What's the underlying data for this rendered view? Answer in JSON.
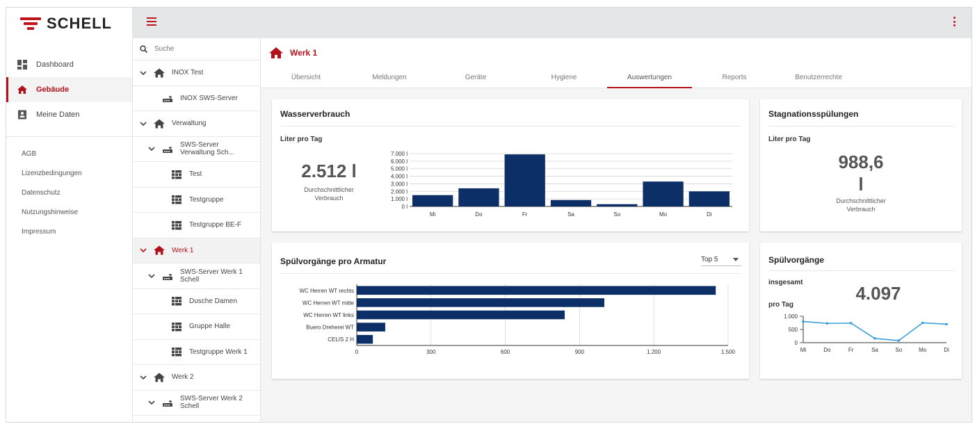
{
  "brand": {
    "name": "SCHELL",
    "color": "#c0141e"
  },
  "sidebar": {
    "nav": [
      {
        "label": "Dashboard",
        "icon": "dashboard-icon",
        "active": false
      },
      {
        "label": "Gebäude",
        "icon": "home-icon",
        "active": true
      },
      {
        "label": "Meine Daten",
        "icon": "contact-card-icon",
        "active": false
      }
    ],
    "links": [
      "AGB",
      "Lizenzbedingungen",
      "Datenschutz",
      "Nutzungshinweise",
      "Impressum"
    ]
  },
  "search": {
    "placeholder": "Suche"
  },
  "tree": [
    {
      "label": "INOX Test",
      "type": "building",
      "indent": 0,
      "expanded": true
    },
    {
      "label": "INOX SWS-Server",
      "type": "server",
      "indent": 1,
      "expanded": null
    },
    {
      "label": "Verwaltung",
      "type": "building",
      "indent": 0,
      "expanded": true
    },
    {
      "label": "SWS-Server\nVerwaltung Sch...",
      "type": "server",
      "indent": 1,
      "expanded": true
    },
    {
      "label": "Test",
      "type": "group",
      "indent": 2,
      "expanded": null
    },
    {
      "label": "Testgruppe",
      "type": "group",
      "indent": 2,
      "expanded": null
    },
    {
      "label": "Testgruppe BE-F",
      "type": "group",
      "indent": 2,
      "expanded": null
    },
    {
      "label": "Werk 1",
      "type": "building",
      "indent": 0,
      "expanded": true,
      "active": true
    },
    {
      "label": "SWS-Server Werk 1\nSchell",
      "type": "server",
      "indent": 1,
      "expanded": true
    },
    {
      "label": "Dusche Damen",
      "type": "group",
      "indent": 2,
      "expanded": null
    },
    {
      "label": "Gruppe Halle",
      "type": "group",
      "indent": 2,
      "expanded": null
    },
    {
      "label": "Testgruppe Werk 1",
      "type": "group",
      "indent": 2,
      "expanded": null
    },
    {
      "label": "Werk 2",
      "type": "building",
      "indent": 0,
      "expanded": true
    },
    {
      "label": "SWS-Server Werk 2\nSchell",
      "type": "server",
      "indent": 1,
      "expanded": true
    }
  ],
  "page": {
    "title": "Werk 1"
  },
  "tabs": [
    {
      "label": "Übersicht",
      "active": false
    },
    {
      "label": "Meldungen",
      "active": false
    },
    {
      "label": "Geräte",
      "active": false
    },
    {
      "label": "Hygiene",
      "active": false
    },
    {
      "label": "Auswertungen",
      "active": true
    },
    {
      "label": "Reports",
      "active": false
    },
    {
      "label": "Benutzerrechte",
      "active": false
    }
  ],
  "cards": {
    "water": {
      "title": "Wasserverbrauch",
      "subtitle": "Liter pro Tag",
      "value": "2.512 l",
      "caption": "Durchschnittlicher\nVerbrauch"
    },
    "stagnation": {
      "title": "Stagnationsspülungen",
      "subtitle": "Liter pro Tag",
      "value": "988,6\nl",
      "caption": "Durchschnittlicher\nVerbrauch"
    },
    "flush": {
      "title": "Spülvorgänge pro Armatur",
      "select": "Top 5"
    },
    "flushcount": {
      "title": "Spülvorgänge",
      "total_label": "insgesamt",
      "per_day_label": "pro Tag",
      "value": "4.097"
    }
  },
  "chart_data": [
    {
      "type": "bar",
      "categories": [
        "Mi",
        "Do",
        "Fr",
        "Sa",
        "So",
        "Mo",
        "Di"
      ],
      "values": [
        1500,
        2400,
        6900,
        850,
        300,
        3300,
        2000
      ],
      "ylim": [
        0,
        7000
      ],
      "yticks": [
        "0 l",
        "1.000 l",
        "2.000 l",
        "3.000 l",
        "4.000 l",
        "5.000 l",
        "6.000 l",
        "7.000 l"
      ],
      "color": "#0b2f66",
      "grid": true
    },
    {
      "type": "bar",
      "orientation": "horizontal",
      "categories": [
        "WC Herren WT rechts",
        "WC Herren WT mitte",
        "WC Herren WT links",
        "Buero Dreherei WT",
        "CELIS 2 H"
      ],
      "values": [
        1450,
        1000,
        840,
        115,
        65
      ],
      "xlim": [
        0,
        1500
      ],
      "xticks": [
        "0",
        "300",
        "600",
        "900",
        "1.200",
        "1.500"
      ],
      "color": "#0b2f66",
      "grid": true
    },
    {
      "type": "line",
      "categories": [
        "Mi",
        "Do",
        "Fr",
        "Sa",
        "So",
        "Mo",
        "Di"
      ],
      "values": [
        800,
        730,
        740,
        160,
        80,
        750,
        700
      ],
      "ylim": [
        0,
        1000
      ],
      "yticks": [
        "0",
        "500",
        "1.000"
      ],
      "color": "#3a9fd6",
      "grid": false
    }
  ]
}
